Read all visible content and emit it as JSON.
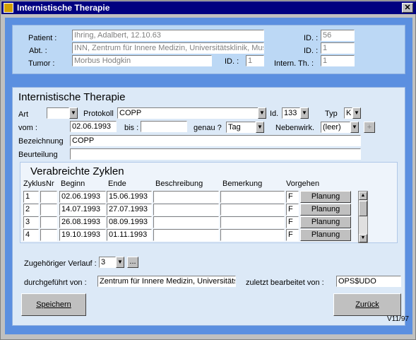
{
  "window": {
    "title": "Internistische Therapie",
    "close_glyph": "✕"
  },
  "header": {
    "patient_label": "Patient :",
    "patient_value": "Ihring, Adalbert, 12.10.63",
    "abt_label": "Abt. :",
    "abt_value": "INN, Zentrum für Innere Medizin, Universitätsklinik, Muste",
    "tumor_label": "Tumor :",
    "tumor_value": "Morbus Hodgkin",
    "tumor_id_label": "ID. :",
    "tumor_id_value": "1",
    "id1_label": "ID. :",
    "id1_value": "56",
    "id2_label": "ID. :",
    "id2_value": "1",
    "intern_label": "Intern. Th. :",
    "intern_value": "1"
  },
  "form": {
    "section_title": "Internistische Therapie",
    "art_label": "Art",
    "art_value": "",
    "protokoll_label": "Protokoll",
    "protokoll_value": "COPP",
    "id_label": "Id.",
    "id_value": "133",
    "typ_label": "Typ",
    "typ_value": "K",
    "vom_label": "vom :",
    "vom_value": "02.06.1993",
    "bis_label": "bis :",
    "bis_value": "",
    "genau_label": "genau ?",
    "genau_value": "Tag",
    "nebenwirk_label": "Nebenwirk.",
    "nebenwirk_value": "(leer)",
    "plus_label": "+",
    "bezeichnung_label": "Bezeichnung",
    "bezeichnung_value": "COPP",
    "beurteilung_label": "Beurteilung",
    "beurteilung_value": ""
  },
  "cycles": {
    "title": "Verabreichte Zyklen",
    "columns": [
      "Zyklus",
      "Nr",
      "Beginn",
      "Ende",
      "Beschreibung",
      "Bemerkung",
      "Vorgehen"
    ],
    "rows": [
      {
        "zyklus": "1",
        "nr": "",
        "beginn": "02.06.1993",
        "ende": "15.06.1993",
        "beschreibung": "",
        "bemerkung": "",
        "vorgehen": "F",
        "action": "Planung"
      },
      {
        "zyklus": "2",
        "nr": "",
        "beginn": "14.07.1993",
        "ende": "27.07.1993",
        "beschreibung": "",
        "bemerkung": "",
        "vorgehen": "F",
        "action": "Planung"
      },
      {
        "zyklus": "3",
        "nr": "",
        "beginn": "26.08.1993",
        "ende": "08.09.1993",
        "beschreibung": "",
        "bemerkung": "",
        "vorgehen": "F",
        "action": "Planung"
      },
      {
        "zyklus": "4",
        "nr": "",
        "beginn": "19.10.1993",
        "ende": "01.11.1993",
        "beschreibung": "",
        "bemerkung": "",
        "vorgehen": "F",
        "action": "Planung"
      }
    ]
  },
  "footer": {
    "verlauf_label": "Zugehöriger Verlauf :",
    "verlauf_value": "3",
    "ellipsis": "...",
    "durch_label": "durchgeführt von :",
    "durch_value": "Zentrum für Innere Medizin, Universitäts",
    "zuletzt_label": "zuletzt bearbeitet von :",
    "zuletzt_value": "OPS$UDO",
    "save_label": "Speichern",
    "back_label": "Zurück",
    "version": "V11/97"
  },
  "colors": {
    "panel": "#5b8fe0",
    "title_bar": "#000080"
  }
}
